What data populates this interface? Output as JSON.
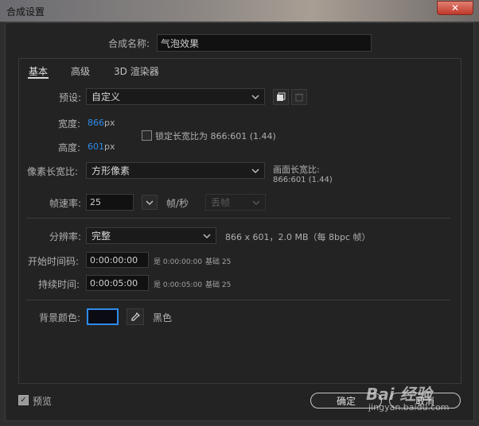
{
  "window": {
    "title": "合成设置",
    "close_glyph": "✕"
  },
  "comp_name": {
    "label": "合成名称:",
    "value": "气泡效果"
  },
  "tabs": [
    {
      "label": "基本",
      "active": true
    },
    {
      "label": "高级",
      "active": false
    },
    {
      "label": "3D 渲染器",
      "active": false
    }
  ],
  "preset": {
    "label": "预设:",
    "value": "自定义"
  },
  "width": {
    "label": "宽度:",
    "value": "866",
    "unit": "px"
  },
  "height": {
    "label": "高度:",
    "value": "601",
    "unit": "px"
  },
  "lock_aspect": {
    "label": "锁定长宽比为 866:601 (1.44)",
    "checked": false
  },
  "pixel_aspect": {
    "label": "像素长宽比:",
    "value": "方形像素"
  },
  "frame_aspect": {
    "label": "画面长宽比:",
    "value": "866:601 (1.44)"
  },
  "frame_rate": {
    "label": "帧速率:",
    "value": "25",
    "unit": "帧/秒",
    "drop_frame": "丢帧"
  },
  "resolution": {
    "label": "分辨率:",
    "value": "完整",
    "info": "866 x 601，2.0 MB（每 8bpc 帧）"
  },
  "start_timecode": {
    "label": "开始时间码:",
    "value": "0:00:00:00",
    "info_is": "是 0:00:00:00",
    "info_base": "基础 25"
  },
  "duration": {
    "label": "持续时间:",
    "value": "0:00:05:00",
    "info_is": "是 0:00:05:00",
    "info_base": "基础 25"
  },
  "background": {
    "label": "背景颜色:",
    "color_name": "黑色",
    "color": "#0b0b14"
  },
  "preview": {
    "label": "预览",
    "checked": true
  },
  "buttons": {
    "ok": "确定",
    "cancel": "取消"
  },
  "watermark": {
    "text": "Bai 经验",
    "url": "jingyan.baidu.com"
  },
  "colors": {
    "accent": "#2d8ceb",
    "bg": "#232323"
  }
}
